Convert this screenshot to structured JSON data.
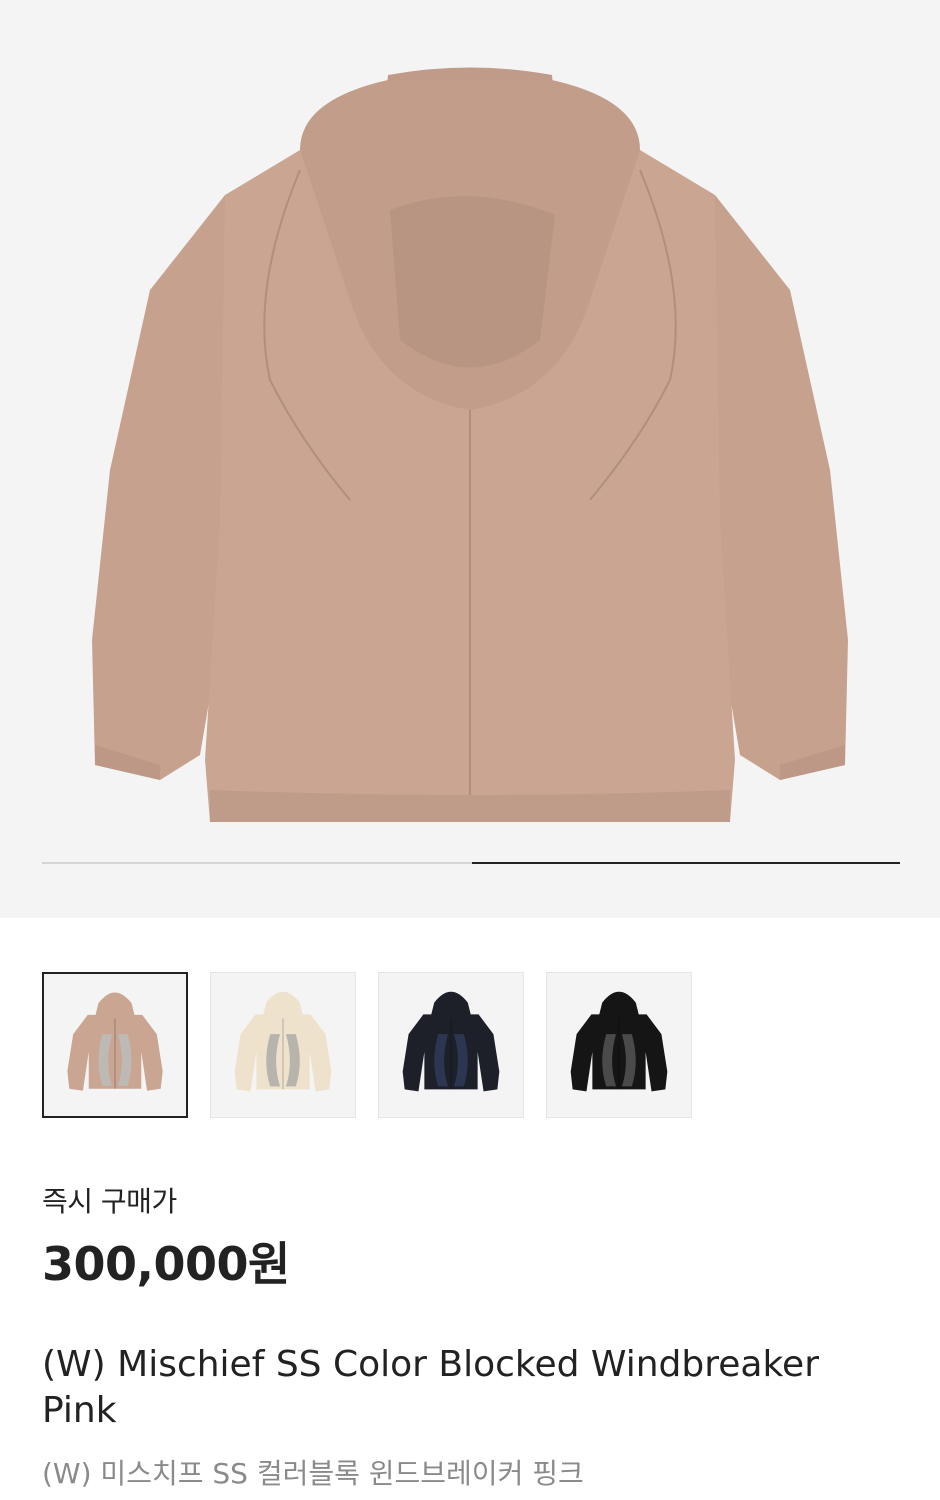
{
  "hero": {
    "image_icon": "jacket-back-image",
    "jacket_color": "#c9a592",
    "background": "#f4f4f4",
    "slide_index": 2,
    "slide_count": 2
  },
  "thumbnails": [
    {
      "icon": "jacket-pink-thumbnail",
      "body": "#c9a592",
      "panel": "#bdbab5",
      "selected": true
    },
    {
      "icon": "jacket-cream-thumbnail",
      "body": "#efe2cd",
      "panel": "#b7b4ae",
      "selected": false
    },
    {
      "icon": "jacket-navy-thumbnail",
      "body": "#1d2029",
      "panel": "#2c3650",
      "selected": false
    },
    {
      "icon": "jacket-black-thumbnail",
      "body": "#151515",
      "panel": "#4a4a4a",
      "selected": false
    }
  ],
  "price": {
    "label": "즉시 구매가",
    "value": "300,000원"
  },
  "product": {
    "name_en": "(W) Mischief SS Color Blocked Windbreaker Pink",
    "name_ko": "(W) 미스치프 SS 컬러블록 윈드브레이커 핑크"
  }
}
